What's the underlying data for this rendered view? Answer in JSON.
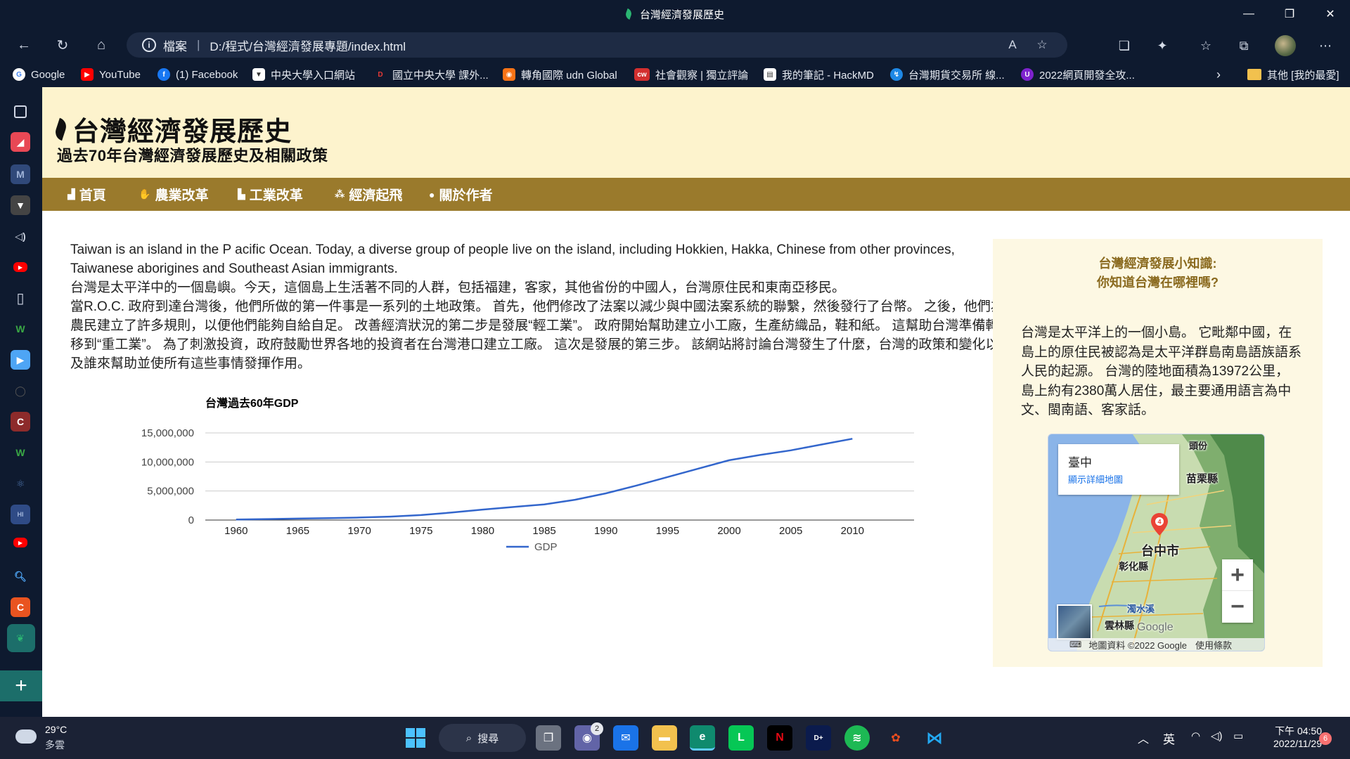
{
  "window": {
    "title": "台灣經濟發展歷史"
  },
  "browser": {
    "address_label": "檔案",
    "url": "D:/程式/台灣經濟發展專題/index.html"
  },
  "bookmarks": [
    {
      "label": "Google",
      "color": "#ffffff",
      "glyph": "G"
    },
    {
      "label": "YouTube",
      "color": "#ff0000",
      "glyph": "▶"
    },
    {
      "label": "(1) Facebook",
      "color": "#1877f2",
      "glyph": "f"
    },
    {
      "label": "中央大學入口網站",
      "color": "#ffffff",
      "glyph": "▼"
    },
    {
      "label": "國立中央大學 課外...",
      "color": "#c62828",
      "glyph": "D"
    },
    {
      "label": "轉角國際 udn Global",
      "color": "#f97316",
      "glyph": "◉"
    },
    {
      "label": "社會觀察 | 獨立評論",
      "color": "#d32f2f",
      "glyph": "cw"
    },
    {
      "label": "我的筆記 - HackMD",
      "color": "#ffffff",
      "glyph": "▤"
    },
    {
      "label": "台灣期貨交易所 線...",
      "color": "#1e88e5",
      "glyph": "↯"
    },
    {
      "label": "2022網頁開發全攻...",
      "color": "#7e22ce",
      "glyph": "U"
    }
  ],
  "bookmarks_other": "其他 [我的最愛]",
  "site": {
    "title": "台灣經濟發展歷史",
    "subtitle": "過去70年台灣經濟發展歷史及相關政策",
    "nav": [
      {
        "label": "首頁",
        "icon": "home-icon"
      },
      {
        "label": "農業改革",
        "icon": "hand-icon"
      },
      {
        "label": "工業改革",
        "icon": "factory-icon"
      },
      {
        "label": "經濟起飛",
        "icon": "network-icon"
      },
      {
        "label": "關於作者",
        "icon": "pin-icon"
      }
    ]
  },
  "article": {
    "en": "Taiwan is an island in the P acific Ocean. Today, a diverse group of people live on the island, including Hokkien, Hakka, Chinese from other provinces, Taiwanese aborigines and Southeast Asian immigrants.",
    "zh1": "台灣是太平洋中的一個島嶼。今天，這個島上生活著不同的人群，包括福建，客家，其他省份的中國人，台灣原住民和東南亞移民。",
    "zh2": "當R.O.C. 政府到達台灣後，他們所做的第一件事是一系列的土地政策。 首先，他們修改了法案以減少與中國法案系統的聯繫，然後發行了台幣。 之後，他們為農民建立了許多規則，以便他們能夠自給自足。 改善經濟狀況的第二步是發展“輕工業”。 政府開始幫助建立小工廠，生產紡織品，鞋和紙。 這幫助台灣準備轉移到“重工業”。 為了刺激投資，政府鼓勵世界各地的投資者在台灣港口建立工廠。 這次是發展的第三步。 該網站將討論台灣發生了什麼，台灣的政策和變化以及誰來幫助並使所有這些事情發揮作用。"
  },
  "chart_data": {
    "type": "line",
    "title": "台灣過去60年GDP",
    "x": [
      1960,
      1962.5,
      1965,
      1967.5,
      1970,
      1972.5,
      1975,
      1977.5,
      1980,
      1982.5,
      1985,
      1987.5,
      1990,
      1992.5,
      1995,
      1997.5,
      2000,
      2002.5,
      2005,
      2007.5,
      2010
    ],
    "series": [
      {
        "name": "GDP",
        "color": "#3366cc",
        "values": [
          100000,
          170000,
          250000,
          330000,
          430000,
          590000,
          860000,
          1300000,
          1800000,
          2250000,
          2700000,
          3500000,
          4600000,
          5950000,
          7400000,
          8850000,
          10300000,
          11200000,
          12000000,
          13000000,
          14000000
        ]
      }
    ],
    "xticks": [
      1960,
      1965,
      1970,
      1975,
      1980,
      1985,
      1990,
      1995,
      2000,
      2005,
      2010
    ],
    "yticks": [
      0,
      5000000,
      10000000,
      15000000
    ],
    "ytick_labels": [
      "0",
      "5,000,000",
      "10,000,000",
      "15,000,000"
    ],
    "ylim": [
      0,
      15000000
    ],
    "xlim": [
      1957.5,
      2015
    ],
    "grid": true,
    "legend_position": "bottom"
  },
  "aside": {
    "question": "台灣經濟發展小知識:",
    "question2": "你知道台灣在哪裡嗎?",
    "paragraph": "台灣是太平洋上的一個小島。 它毗鄰中國，在島上的原住民被認為是太平洋群島南島語族語系人民的起源。 台灣的陸地面積為13972公里，島上約有2380萬人居住，最主要通用語言為中文、閩南語、客家話。"
  },
  "map": {
    "place": "臺中",
    "link": "顯示詳細地圖",
    "labels": [
      "頭份",
      "苗栗縣",
      "台中市",
      "彰化縣",
      "濁水溪",
      "雲林縣"
    ],
    "google": "Google",
    "attribution": "地圖資料 ©2022 Google",
    "terms": "使用條款",
    "zoom_in": "+",
    "zoom_out": "−"
  },
  "taskbar": {
    "temp": "29°C",
    "weather": "多雲",
    "search": "搜尋",
    "ime": "英",
    "time": "下午 04:50",
    "date": "2022/11/29",
    "notifications": "6",
    "teams_badge": "2"
  }
}
